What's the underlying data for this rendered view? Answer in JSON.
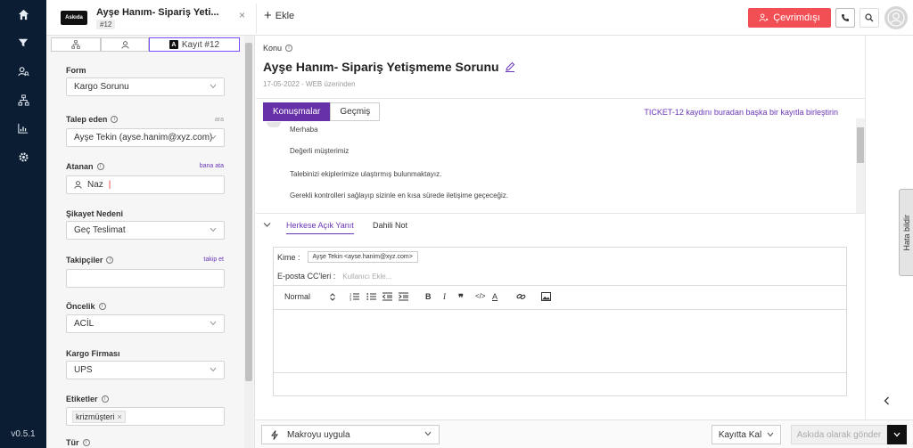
{
  "nav": {
    "icons": [
      "home-icon",
      "filter-icon",
      "users-search-icon",
      "sitemap-icon",
      "chart-icon",
      "gear-icon"
    ],
    "version": "v0.5.1"
  },
  "topbar": {
    "ticket_tab": {
      "logo": "Askıda",
      "title": "Ayşe Hanım- Sipariş Yeti...",
      "number": "#12"
    },
    "add_label": "Ekle",
    "offline_label": "Çevrimdışı",
    "colors": {
      "offline": "#f24f55"
    }
  },
  "left_panel": {
    "tab_active": "Kayıt #12",
    "tab_badge": "A",
    "fields": {
      "form": {
        "label": "Form",
        "value": "Kargo Sorunu"
      },
      "requester": {
        "label": "Talep eden",
        "link": "ara",
        "value": "Ayşe Tekin (ayse.hanim@xyz.com)"
      },
      "assignee": {
        "label": "Atanan",
        "link": "bana ata",
        "value": "Naz"
      },
      "complaint": {
        "label": "Şikayet Nedeni",
        "value": "Geç Teslimat"
      },
      "followers": {
        "label": "Takipçiler",
        "link": "takip et",
        "value": ""
      },
      "priority": {
        "label": "Öncelik",
        "value": "ACİL"
      },
      "carrier": {
        "label": "Kargo Firması",
        "value": "UPS"
      },
      "tags": {
        "label": "Etiketler",
        "chip": "krizmüşteri",
        "chip_close": "×"
      },
      "type": {
        "label": "Tür"
      }
    }
  },
  "main": {
    "konu_label": "Konu",
    "subject": "Ayşe Hanım- Sipariş Yetişmeme Sorunu",
    "meta": "17-05-2022 - WEB üzerinden",
    "conv_tabs": [
      "Konuşmalar",
      "Geçmiş"
    ],
    "merge_link": "TICKET-12 kaydını buradan başka bir kayıtla birleştirin",
    "messages": [
      "Merhaba",
      "Değerli müşterimiz",
      "Talebinizi ekiplerimize ulaştırmış bulunmaktayız.",
      "Gerekli kontrolleri sağlayıp sizinle en kısa sürede iletişime geçeceğiz."
    ],
    "reply_tabs": [
      "Herkese Açık Yanıt",
      "Dahili Not"
    ],
    "editor": {
      "to_label": "Kime :",
      "to_chip": "Ayşe Tekin <ayse.hanim@xyz.com>",
      "cc_label": "E-posta CC'leri :",
      "cc_placeholder": "Kullanıcı Ekle...",
      "format_select": "Normal"
    },
    "colors": {
      "accent": "#6630a8",
      "link": "#6a36b8"
    }
  },
  "right": {
    "feedback_tab": "Hata bildir"
  },
  "bottom": {
    "macro_label": "Makroyu uygula",
    "stay_label": "Kayıtta Kal",
    "send_label": "Askıda olarak gönder"
  }
}
